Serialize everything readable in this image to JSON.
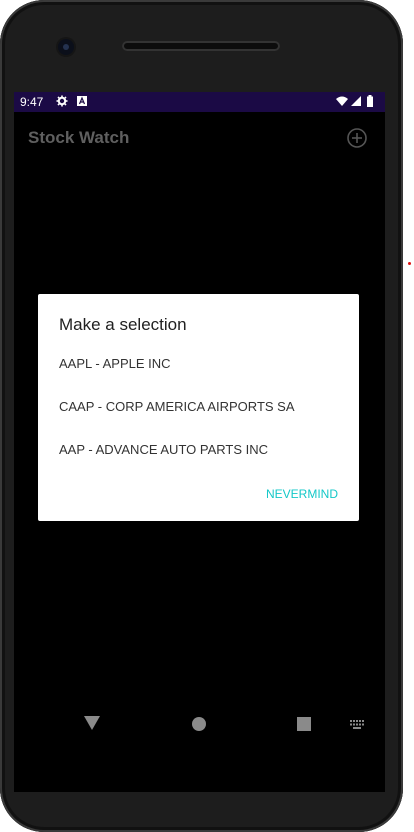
{
  "status_bar": {
    "time": "9:47",
    "left_icons": [
      "gear-icon",
      "a-badge-icon"
    ],
    "right_icons": [
      "wifi-icon",
      "signal-icon",
      "battery-icon"
    ],
    "background": "#1b0a45"
  },
  "app_bar": {
    "title": "Stock Watch",
    "action_icon": "add-circle-icon"
  },
  "dialog": {
    "title": "Make a selection",
    "options": [
      {
        "label": "AAPL - APPLE INC"
      },
      {
        "label": "CAAP - CORP AMERICA AIRPORTS SA"
      },
      {
        "label": "AAP - ADVANCE AUTO PARTS INC"
      }
    ],
    "negative_button": "NEVERMIND",
    "accent_color": "#14c8c8"
  },
  "nav_bar": {
    "icons": [
      "back-icon",
      "home-icon",
      "recents-icon",
      "keyboard-icon"
    ]
  }
}
